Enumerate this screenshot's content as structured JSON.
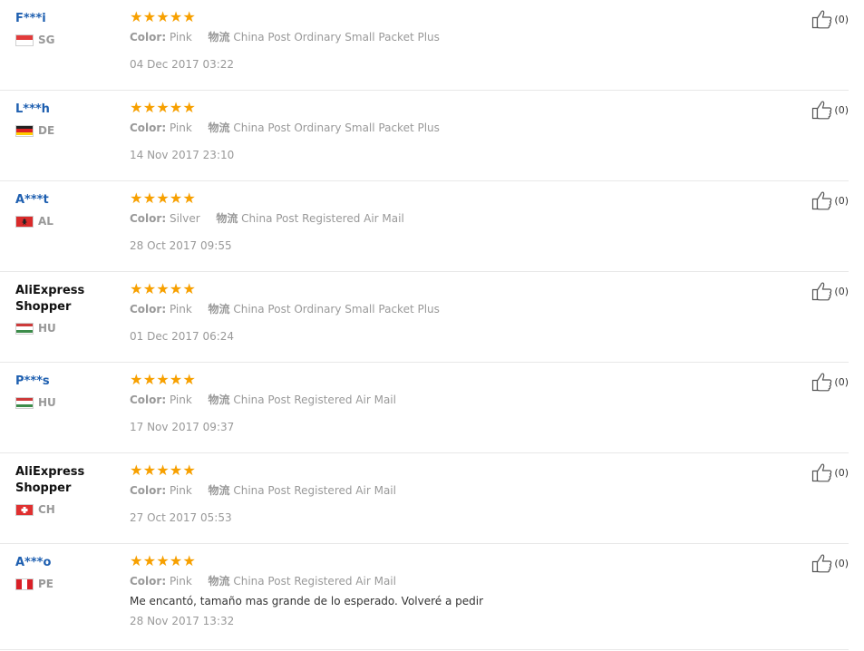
{
  "reviews": [
    {
      "user": "F***i",
      "anonymous": true,
      "country": "SG",
      "flag": "sg",
      "stars": 5,
      "color_label": "Color:",
      "color_value": "Pink",
      "shipping_label": "物流",
      "shipping_value": "China Post Ordinary Small Packet Plus",
      "feedback": "",
      "date": "04 Dec 2017 03:22",
      "helpful": "(0)"
    },
    {
      "user": "L***h",
      "anonymous": true,
      "country": "DE",
      "flag": "de",
      "stars": 5,
      "color_label": "Color:",
      "color_value": "Pink",
      "shipping_label": "物流",
      "shipping_value": "China Post Ordinary Small Packet Plus",
      "feedback": "",
      "date": "14 Nov 2017 23:10",
      "helpful": "(0)"
    },
    {
      "user": "A***t",
      "anonymous": true,
      "country": "AL",
      "flag": "al",
      "stars": 5,
      "color_label": "Color:",
      "color_value": "Silver",
      "shipping_label": "物流",
      "shipping_value": "China Post Registered Air Mail",
      "feedback": "",
      "date": "28 Oct 2017 09:55",
      "helpful": "(0)"
    },
    {
      "user": "AliExpress Shopper",
      "anonymous": false,
      "country": "HU",
      "flag": "hu",
      "stars": 5,
      "color_label": "Color:",
      "color_value": "Pink",
      "shipping_label": "物流",
      "shipping_value": "China Post Ordinary Small Packet Plus",
      "feedback": "",
      "date": "01 Dec 2017 06:24",
      "helpful": "(0)"
    },
    {
      "user": "P***s",
      "anonymous": true,
      "country": "HU",
      "flag": "hu",
      "stars": 5,
      "color_label": "Color:",
      "color_value": "Pink",
      "shipping_label": "物流",
      "shipping_value": "China Post Registered Air Mail",
      "feedback": "",
      "date": "17 Nov 2017 09:37",
      "helpful": "(0)"
    },
    {
      "user": "AliExpress Shopper",
      "anonymous": false,
      "country": "CH",
      "flag": "ch",
      "stars": 5,
      "color_label": "Color:",
      "color_value": "Pink",
      "shipping_label": "物流",
      "shipping_value": "China Post Registered Air Mail",
      "feedback": "",
      "date": "27 Oct 2017 05:53",
      "helpful": "(0)"
    },
    {
      "user": "A***o",
      "anonymous": true,
      "country": "PE",
      "flag": "pe",
      "stars": 5,
      "color_label": "Color:",
      "color_value": "Pink",
      "shipping_label": "物流",
      "shipping_value": "China Post Registered Air Mail",
      "feedback": "Me encantó, tamaño mas grande de lo esperado. Volveré a pedir",
      "date": "28 Nov 2017 13:32",
      "helpful": "(0)"
    }
  ],
  "colors": {
    "star": "#f7a000",
    "user_link": "#1e5fb0",
    "muted": "#999999",
    "divider": "#e8e8e8"
  },
  "icons": {
    "star": "star-icon",
    "helpful": "thumbs-up-icon"
  }
}
